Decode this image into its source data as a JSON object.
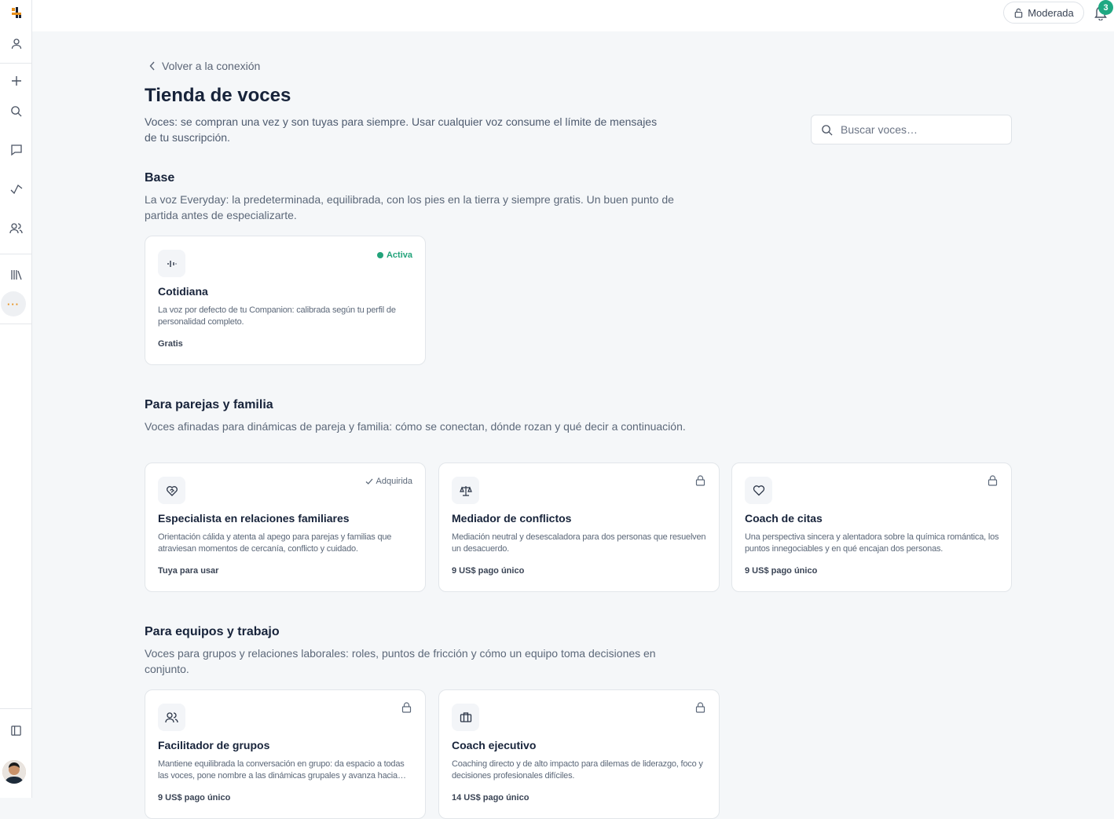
{
  "topbar": {
    "mode_label": "Moderada",
    "notification_count": "3"
  },
  "back_link": "Volver a la conexión",
  "page": {
    "title": "Tienda de voces",
    "subtitle": "Voces: se compran una vez y son tuyas para siempre. Usar cualquier voz consume el límite de mensajes de tu suscripción."
  },
  "search": {
    "placeholder": "Buscar voces…"
  },
  "sections": [
    {
      "title": "Base",
      "description": "La voz Everyday: la predeterminada, equilibrada, con los pies en la tierra y siempre gratis. Un buen punto de partida antes de especializarte.",
      "cards": [
        {
          "title": "Cotidiana",
          "desc": "La voz por defecto de tu Companion: calibrada según tu perfil de personalidad completo.",
          "price": "Gratis",
          "status": "Activa",
          "icon": "waveform-icon"
        }
      ]
    },
    {
      "title": "Para parejas y familia",
      "description": "Voces afinadas para dinámicas de pareja y familia: cómo se conectan, dónde rozan y qué decir a continuación.",
      "cards": [
        {
          "title": "Especialista en relaciones familiares",
          "desc": "Orientación cálida y atenta al apego para parejas y familias que atraviesan momentos de cercanía, conflicto y cuidado.",
          "price": "Tuya para usar",
          "status": "Adquirida",
          "icon": "heart-handshake-icon"
        },
        {
          "title": "Mediador de conflictos",
          "desc": "Mediación neutral y desescaladora para dos personas que resuelven un desacuerdo.",
          "price": "9 US$ pago único",
          "icon": "scale-icon"
        },
        {
          "title": "Coach de citas",
          "desc": "Una perspectiva sincera y alentadora sobre la química romántica, los puntos innegociables y en qué encajan dos personas.",
          "price": "9 US$ pago único",
          "icon": "heart-icon"
        }
      ]
    },
    {
      "title": "Para equipos y trabajo",
      "description": "Voces para grupos y relaciones laborales: roles, puntos de fricción y cómo un equipo toma decisiones en conjunto.",
      "cards": [
        {
          "title": "Facilitador de grupos",
          "desc": "Mantiene equilibrada la conversación en grupo: da espacio a todas las voces, pone nombre a las dinámicas grupales y avanza hacia acuerdos.",
          "price": "9 US$ pago único",
          "icon": "users-icon"
        },
        {
          "title": "Coach ejecutivo",
          "desc": "Coaching directo y de alto impacto para dilemas de liderazgo, foco y decisiones profesionales difíciles.",
          "price": "14 US$ pago único",
          "icon": "briefcase-icon"
        }
      ]
    }
  ],
  "colors": {
    "accent": "#1fa882",
    "active": "#22a37a",
    "brand_orange": "#e8901b",
    "background": "#f5f7f9"
  }
}
